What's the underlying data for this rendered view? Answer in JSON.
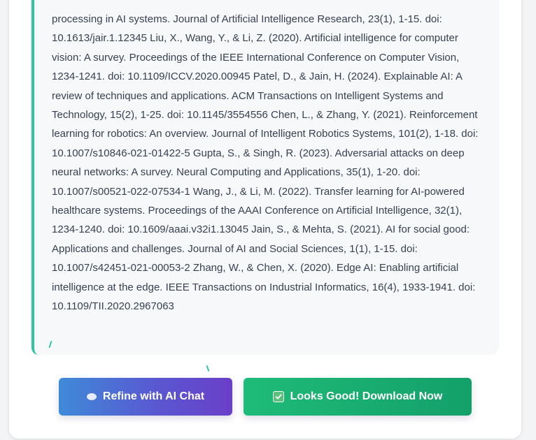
{
  "references": {
    "text": "processing in AI systems. Journal of Artificial Intelligence Research, 23(1), 1-15. doi: 10.1613/jair.1.12345 Liu, X., Wang, Y., & Li, Z. (2020). Artificial intelligence for computer vision: A survey. Proceedings of the IEEE International Conference on Computer Vision, 1234-1241. doi: 10.1109/ICCV.2020.00945 Patel, D., & Jain, H. (2024). Explainable AI: A review of techniques and applications. ACM Transactions on Intelligent Systems and Technology, 15(2), 1-25. doi: 10.1145/3554556 Chen, L., & Zhang, Y. (2021). Reinforcement learning for robotics: An overview. Journal of Intelligent Robotics Systems, 101(2), 1-18. doi: 10.1007/s10846-021-01422-5 Gupta, S., & Singh, R. (2023). Adversarial attacks on deep neural networks: A survey. Neural Computing and Applications, 35(1), 1-20. doi: 10.1007/s00521-022-07534-1 Wang, J., & Li, M. (2022). Transfer learning for AI-powered healthcare systems. Proceedings of the AAAI Conference on Artificial Intelligence, 32(1), 1234-1240. doi: 10.1609/aaai.v32i1.13045 Jain, S., & Mehta, S. (2021). AI for social good: Applications and challenges. Journal of AI and Social Sciences, 1(1), 1-15. doi: 10.1007/s42451-021-00053-2 Zhang, W., & Chen, X. (2020). Edge AI: Enabling artificial intelligence at the edge. IEEE Transactions on Industrial Informatics, 16(4), 1933-1941. doi: 10.1109/TII.2020.2967063"
  },
  "actions": {
    "refine_label": "Refine with AI Chat",
    "refine_icon": "chat-bubble-icon",
    "download_label": "Looks Good! Download Now",
    "download_icon": "checkbox-icon"
  },
  "colors": {
    "accent_border": "#2ec4a6",
    "refine_gradient_start": "#3f8ad8",
    "refine_gradient_end": "#6a3fc9",
    "download_green": "#13a06a"
  }
}
